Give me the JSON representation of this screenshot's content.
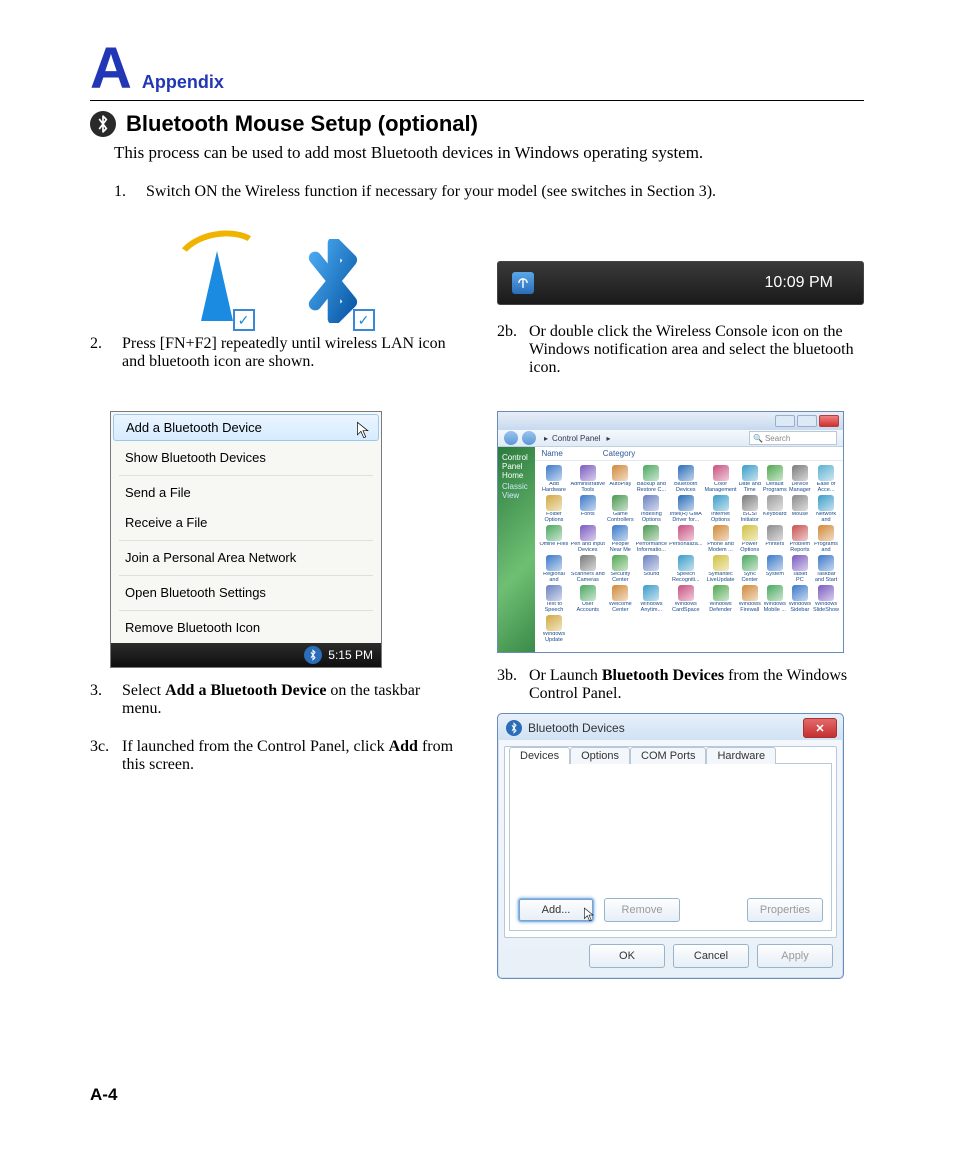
{
  "header": {
    "big_letter": "A",
    "label": "Appendix"
  },
  "section": {
    "title": "Bluetooth Mouse Setup (optional)",
    "intro": "This process can be used to add most Bluetooth devices in Windows operating system."
  },
  "steps": {
    "s1": {
      "num": "1.",
      "text": "Switch ON the Wireless function if necessary for your model (see switches in Section 3)."
    },
    "s2": {
      "num": "2.",
      "text": "Press [FN+F2] repeatedly until wireless LAN icon and bluetooth icon are shown."
    },
    "s2b": {
      "num": "2b.",
      "text": "Or double click the Wireless Console icon on the Windows notification area and select the bluetooth icon."
    },
    "s3": {
      "num": "3.",
      "pre": "Select ",
      "bold": "Add a Bluetooth Device",
      "post": " on the taskbar menu."
    },
    "s3b": {
      "num": "3b.",
      "pre": "Or Launch ",
      "bold": "Bluetooth Devices",
      "post": " from the Windows Control Panel."
    },
    "s3c": {
      "num": "3c.",
      "pre": "If launched from the Control Panel, click ",
      "bold": "Add",
      "post": " from this screen."
    }
  },
  "taskbar_clock": {
    "time": "10:09 PM"
  },
  "bt_menu": {
    "items": [
      "Add a Bluetooth Device",
      "Show Bluetooth Devices",
      "Send a File",
      "Receive a File",
      "Join a Personal Area Network",
      "Open Bluetooth Settings",
      "Remove Bluetooth Icon"
    ],
    "tray_time": "5:15 PM"
  },
  "control_panel": {
    "breadcrumb": "Control Panel",
    "search_placeholder": "Search",
    "side_heading": "Control Panel Home",
    "side_link": "Classic View",
    "col_name": "Name",
    "col_cat": "Category",
    "items": [
      "Add Hardware",
      "Administrative Tools",
      "AutoPlay",
      "Backup and Restore C...",
      "Bluetooth Devices",
      "Color Management",
      "Date and Time",
      "Default Programs",
      "Device Manager",
      "Ease of Acce...",
      "Folder Options",
      "Fonts",
      "Game Controllers",
      "Indexing Options",
      "Intel(R) GMA Driver for...",
      "Internet Options",
      "iSCSI Initiator",
      "Keyboard",
      "Mouse",
      "Network and Sharing Ce...",
      "Offline Files",
      "Pen and Input Devices",
      "People Near Me",
      "Performance Informatio...",
      "Personaliza...",
      "Phone and Modem ...",
      "Power Options",
      "Printers",
      "Problem Reports a...",
      "Programs and Features",
      "Regional and Language...",
      "Scanners and Cameras",
      "Security Center",
      "Sound",
      "Speech Recogniti...",
      "Symantec LiveUpdate",
      "Sync Center",
      "System",
      "Tablet PC Settings",
      "Taskbar and Start Menu",
      "Text to Speech",
      "User Accounts",
      "Welcome Center",
      "Windows Anytim...",
      "Windows CardSpace",
      "Windows Defender",
      "Windows Firewall",
      "Windows Mobile ...",
      "Windows Sidebar ...",
      "Windows SlideShow",
      "Windows Update"
    ],
    "item_colors": [
      "#3a78c8",
      "#7a5ac0",
      "#d08838",
      "#4aa860",
      "#2a6db8",
      "#c85080",
      "#3a9cc8",
      "#50a850",
      "#7a7a7a",
      "#5ab0d0",
      "#d0a840",
      "#3a78c8",
      "#4a9850",
      "#6a80c0",
      "#2a6db8",
      "#3a9cc8",
      "#7a7a7a",
      "#9a9a9a",
      "#8a8a8a",
      "#3a9cc8",
      "#4aa860",
      "#7a5ac0",
      "#3a78c8",
      "#4a9850",
      "#c85080",
      "#d08838",
      "#d0c040",
      "#8a8a8a",
      "#c85050",
      "#d08838",
      "#3a78c8",
      "#7a7a7a",
      "#50a850",
      "#6a80c0",
      "#3a9cc8",
      "#d0c040",
      "#4aa860",
      "#3a78c8",
      "#7a5ac0",
      "#3a78c8",
      "#6a80c0",
      "#4aa860",
      "#d08838",
      "#3a9cc8",
      "#c85080",
      "#50a850",
      "#d08838",
      "#4aa860",
      "#3a78c8",
      "#7a5ac0",
      "#d0a840"
    ]
  },
  "bt_devices": {
    "title": "Bluetooth Devices",
    "tabs": [
      "Devices",
      "Options",
      "COM Ports",
      "Hardware"
    ],
    "selected_tab": 0,
    "buttons": {
      "add": "Add...",
      "remove": "Remove",
      "properties": "Properties",
      "ok": "OK",
      "cancel": "Cancel",
      "apply": "Apply"
    }
  },
  "page_number": "A-4"
}
